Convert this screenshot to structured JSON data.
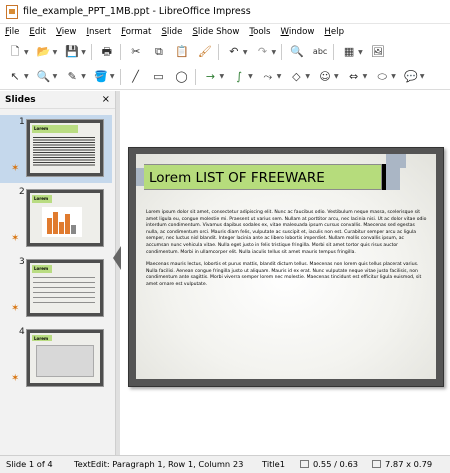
{
  "window": {
    "title": "file_example_PPT_1MB.ppt - LibreOffice Impress"
  },
  "menu": [
    "File",
    "Edit",
    "View",
    "Insert",
    "Format",
    "Slide",
    "Slide Show",
    "Tools",
    "Window",
    "Help"
  ],
  "slides_panel": {
    "title": "Slides",
    "close": "×"
  },
  "thumbnails": [
    {
      "number": "1",
      "title": "Lorem"
    },
    {
      "number": "2",
      "title": "Lorem"
    },
    {
      "number": "3",
      "title": "Lorem"
    },
    {
      "number": "4",
      "title": "Lorem"
    }
  ],
  "slide": {
    "title": "Lorem LIST OF FREEWARE",
    "paragraph1": "Lorem ipsum dolor sit amet, consectetur adipiscing elit. Nunc ac faucibus odio. Vestibulum neque massa, scelerisque sit amet ligula eu, congue molestie mi. Praesent ut varius sem. Nullam at porttitor arcu, nec lacinia nisi. Ut ac dolor vitae odio interdum condimentum. Vivamus dapibus sodales ex, vitae malesuada ipsum cursus convallis. Maecenas sed egestas nulla, ac condimentum orci. Mauris diam felis, vulputate ac suscipit et, iaculis non est. Curabitur semper arcu ac ligula semper, nec luctus nisl blandit. Integer lacinia ante ac libero lobortis imperdiet. Nullam mollis convallis ipsum, ac accumsan nunc vehicula vitae. Nulla eget justo in felis tristique fringilla. Morbi sit amet tortor quis risus auctor condimentum. Morbi in ullamcorper elit. Nulla iaculis tellus sit amet mauris tempus fringilla.",
    "paragraph2": "Maecenas mauris lectus, lobortis et purus mattis, blandit dictum tellus. Maecenas non lorem quis tellus placerat varius. Nulla facilisi. Aenean congue fringilla justo ut aliquam. Mauris id ex erat. Nunc vulputate neque vitae justo facilisis, non condimentum ante sagittis. Morbi viverra semper lorem nec molestie. Maecenas tincidunt est efficitur ligula euismod, sit amet ornare est vulputate."
  },
  "status": {
    "slide": "Slide 1 of 4",
    "edit": "TextEdit: Paragraph 1, Row 1, Column 23",
    "layout": "Title1",
    "position": "0.55 / 0.63",
    "size": "7.87 x 0.79"
  },
  "colors": {
    "title_fill": "#b6dc7c",
    "slide_frame": "#545454",
    "accent_blue": "#aab6c5"
  }
}
